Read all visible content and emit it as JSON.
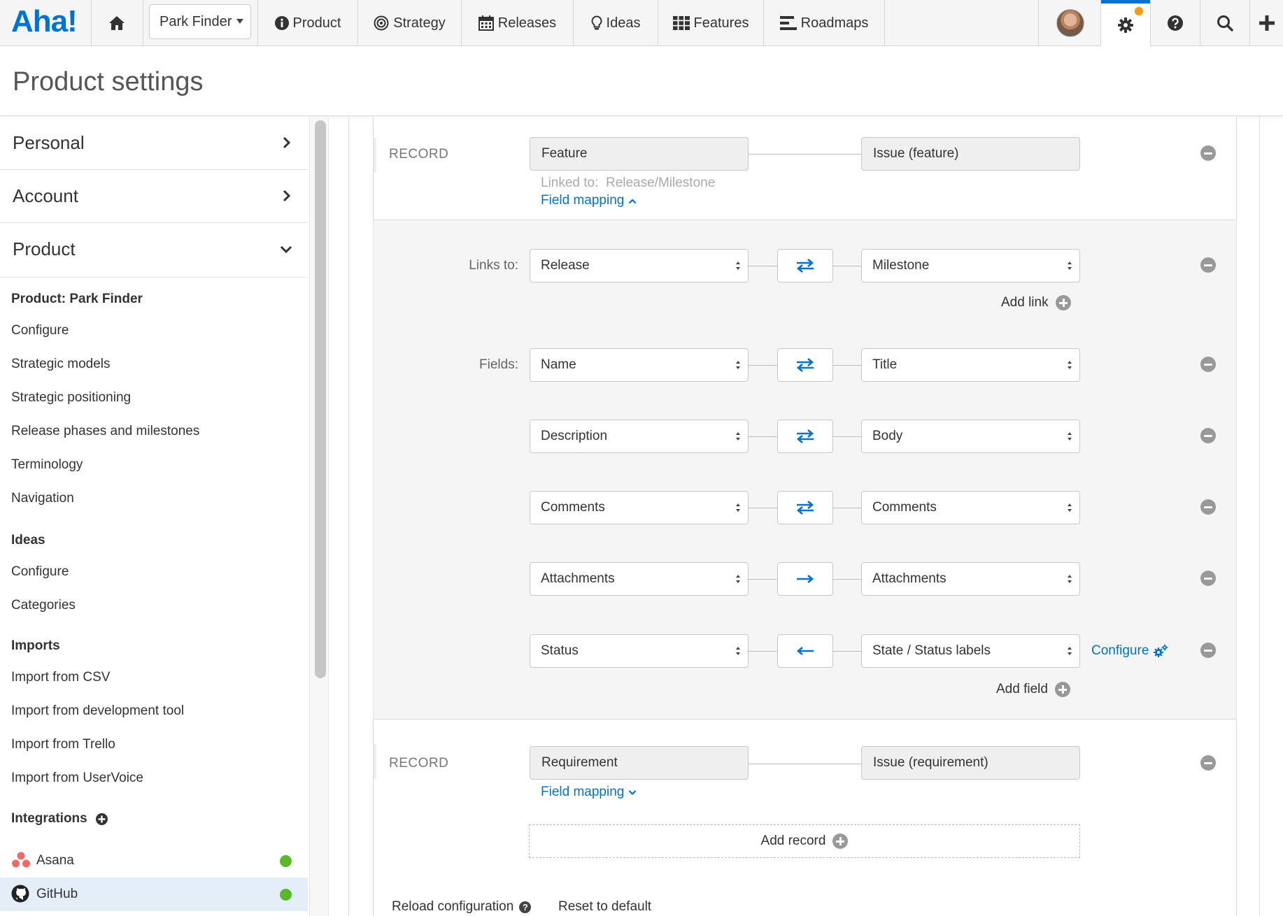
{
  "topbar": {
    "logo": "Aha!",
    "product_selector": "Park Finder",
    "nav": [
      {
        "label": "Product",
        "icon": "info-icon"
      },
      {
        "label": "Strategy",
        "icon": "target-icon"
      },
      {
        "label": "Releases",
        "icon": "calendar-icon"
      },
      {
        "label": "Ideas",
        "icon": "lightbulb-icon"
      },
      {
        "label": "Features",
        "icon": "grid-icon"
      },
      {
        "label": "Roadmaps",
        "icon": "roadmap-icon"
      }
    ],
    "right_icons": [
      "avatar",
      "gear-icon",
      "help-icon",
      "search-icon",
      "plus-icon"
    ]
  },
  "page": {
    "title": "Product settings"
  },
  "sidebar": {
    "sections": [
      "Personal",
      "Account",
      "Product"
    ],
    "product_group": "Product: Park Finder",
    "product_links": [
      "Configure",
      "Strategic models",
      "Strategic positioning",
      "Release phases and milestones",
      "Terminology",
      "Navigation"
    ],
    "ideas_group": "Ideas",
    "ideas_links": [
      "Configure",
      "Categories"
    ],
    "imports_group": "Imports",
    "imports_links": [
      "Import from CSV",
      "Import from development tool",
      "Import from Trello",
      "Import from UserVoice"
    ],
    "integrations_group": "Integrations",
    "integrations": [
      {
        "name": "Asana",
        "status_color": "#5ab82b"
      },
      {
        "name": "GitHub",
        "status_color": "#5ab82b"
      }
    ]
  },
  "records": [
    {
      "label": "RECORD",
      "aha_record": "Feature",
      "remote_record": "Issue (feature)",
      "linked_to_label": "Linked to:",
      "linked_to_value": "Release/Milestone",
      "field_mapping_label": "Field mapping"
    },
    {
      "label": "RECORD",
      "aha_record": "Requirement",
      "remote_record": "Issue (requirement)",
      "field_mapping_label": "Field mapping"
    }
  ],
  "mapping": {
    "links_label": "Links to:",
    "links": [
      {
        "aha": "Release",
        "direction": "both",
        "remote": "Milestone"
      }
    ],
    "add_link": "Add link",
    "fields_label": "Fields:",
    "fields": [
      {
        "aha": "Name",
        "direction": "both",
        "remote": "Title"
      },
      {
        "aha": "Description",
        "direction": "both",
        "remote": "Body"
      },
      {
        "aha": "Comments",
        "direction": "both",
        "remote": "Comments"
      },
      {
        "aha": "Attachments",
        "direction": "right",
        "remote": "Attachments"
      },
      {
        "aha": "Status",
        "direction": "left",
        "remote": "State / Status labels",
        "configure": "Configure"
      }
    ],
    "add_field": "Add field"
  },
  "add_record": "Add record",
  "footer": {
    "reload": "Reload configuration",
    "reset": "Reset to default"
  },
  "colors": {
    "accent": "#0073cf",
    "status_ok": "#5ab82b",
    "notif": "#f39c12"
  }
}
